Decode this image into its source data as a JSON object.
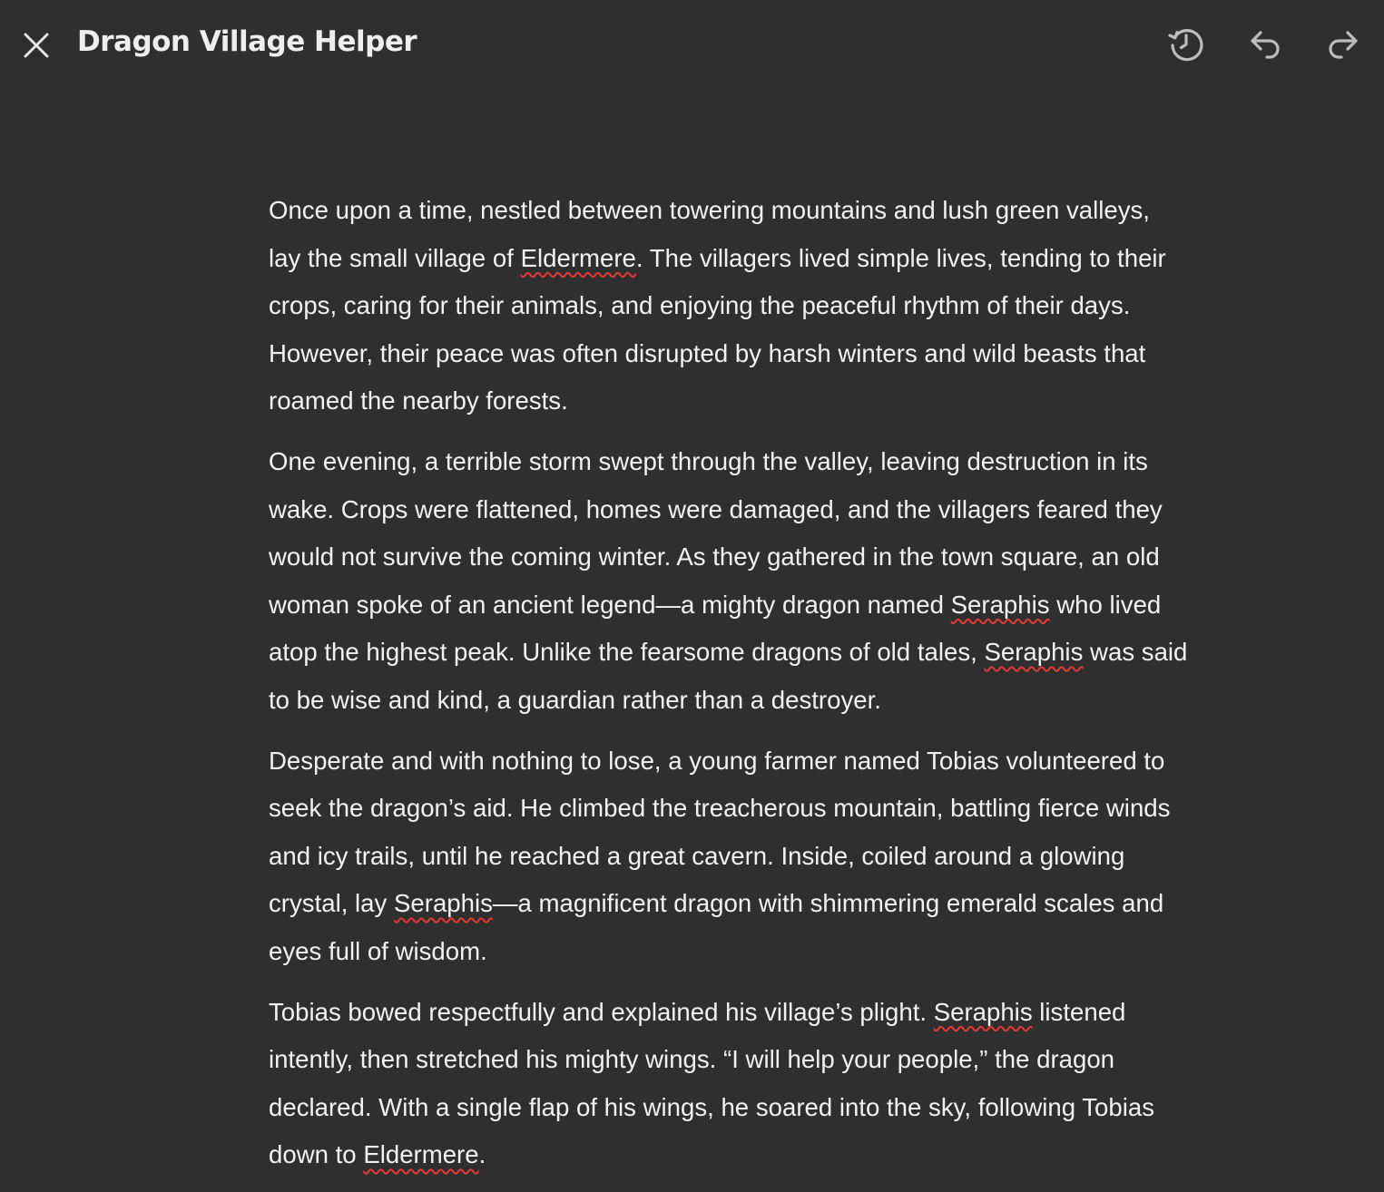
{
  "header": {
    "title": "Dragon Village Helper",
    "close_icon": "close-icon",
    "history_icon": "history-icon",
    "undo_icon": "undo-icon",
    "redo_icon": "redo-icon"
  },
  "document": {
    "paragraphs": [
      {
        "lines": [
          [
            "Once upon a time, nestled between towering mountains and lush green valleys,"
          ],
          [
            "lay the small village of ",
            "Eldermere",
            ". The villagers lived simple lives, tending to their"
          ],
          [
            "crops, caring for their animals, and enjoying the peaceful rhythm of their days."
          ],
          [
            "However, their peace was often disrupted by harsh winters and wild beasts that"
          ],
          [
            "roamed the nearby forests."
          ]
        ]
      },
      {
        "lines": [
          [
            "One evening, a terrible storm swept through the valley, leaving destruction in its"
          ],
          [
            "wake. Crops were flattened, homes were damaged, and the villagers feared they"
          ],
          [
            "would not survive the coming winter. As they gathered in the town square, an old"
          ],
          [
            "woman spoke of an ancient legend—a mighty dragon named ",
            "Seraphis",
            " who lived"
          ],
          [
            "atop the highest peak. Unlike the fearsome dragons of old tales, ",
            "Seraphis",
            " was said"
          ],
          [
            "to be wise and kind, a guardian rather than a destroyer."
          ]
        ]
      },
      {
        "lines": [
          [
            "Desperate and with nothing to lose, a young farmer named Tobias volunteered to"
          ],
          [
            "seek the dragon’s aid. He climbed the treacherous mountain, battling fierce winds"
          ],
          [
            "and icy trails, until he reached a great cavern. Inside, coiled around a glowing"
          ],
          [
            "crystal, lay ",
            "Seraphis",
            "—a magnificent dragon with shimmering emerald scales and"
          ],
          [
            "eyes full of wisdom."
          ]
        ]
      },
      {
        "lines": [
          [
            "Tobias bowed respectfully and explained his village’s plight. ",
            "Seraphis",
            " listened"
          ],
          [
            "intently, then stretched his mighty wings. “I will help your people,” the dragon"
          ],
          [
            "declared. With a single flap of his wings, he soared into the sky, following Tobias"
          ],
          [
            "down to ",
            "Eldermere",
            "."
          ]
        ]
      }
    ]
  },
  "colors": {
    "background": "#2f2f2f",
    "text": "#f2f2f2",
    "icon": "#bdbdbd",
    "spellcheck": "#e53935"
  }
}
